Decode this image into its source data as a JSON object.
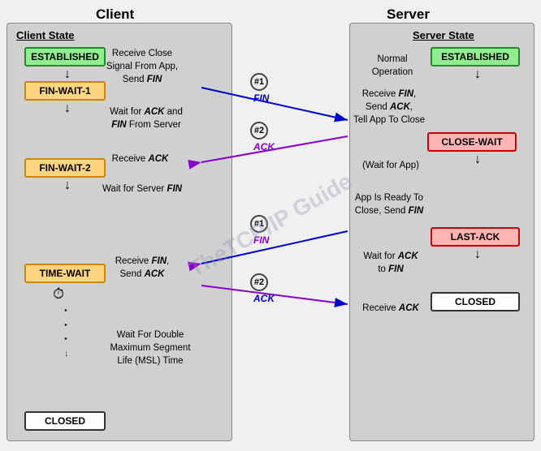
{
  "page": {
    "title_client": "Client",
    "title_server": "Server",
    "client_state_label": "Client State",
    "server_state_label": "Server State",
    "watermark": "TheTCP/IP Guide",
    "states": {
      "established_client": "ESTABLISHED",
      "fin_wait_1": "FIN-WAIT-1",
      "fin_wait_2": "FIN-WAIT-2",
      "time_wait": "TIME-WAIT",
      "closed_client": "CLOSED",
      "established_server": "ESTABLISHED",
      "close_wait": "CLOSE-WAIT",
      "last_ack": "LAST-ACK",
      "closed_server": "CLOSED"
    },
    "descriptions": {
      "client_1": "Receive Close Signal From App, Send FIN",
      "client_2": "Wait for ACK and FIN From Server",
      "client_3": "Receive ACK",
      "client_4": "Wait for Server FIN",
      "client_5": "Receive FIN, Send ACK",
      "client_6": "Wait For Double Maximum Segment Life (MSL) Time",
      "server_1": "Normal Operation",
      "server_2": "Receive FIN, Send ACK, Tell App To Close",
      "server_3": "(Wait for App)",
      "server_4": "App Is Ready To Close, Send FIN",
      "server_5": "Wait for ACK to FIN",
      "server_6": "Receive ACK"
    },
    "labels": {
      "fin1": "FIN",
      "ack2": "ACK",
      "fin1_server": "FIN",
      "ack2_server": "ACK"
    }
  }
}
